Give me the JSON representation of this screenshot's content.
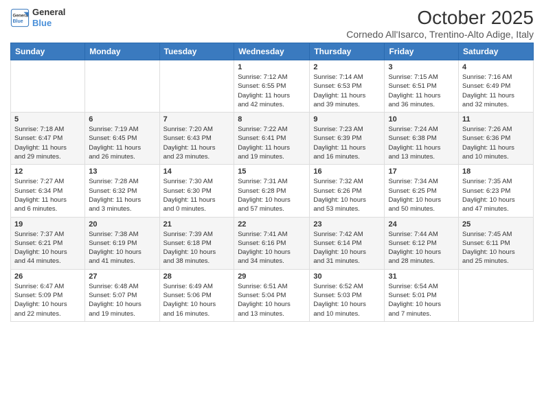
{
  "header": {
    "logo_line1": "General",
    "logo_line2": "Blue",
    "month_title": "October 2025",
    "subtitle": "Cornedo All'Isarco, Trentino-Alto Adige, Italy"
  },
  "weekdays": [
    "Sunday",
    "Monday",
    "Tuesday",
    "Wednesday",
    "Thursday",
    "Friday",
    "Saturday"
  ],
  "weeks": [
    [
      {
        "day": "",
        "info": ""
      },
      {
        "day": "",
        "info": ""
      },
      {
        "day": "",
        "info": ""
      },
      {
        "day": "1",
        "info": "Sunrise: 7:12 AM\nSunset: 6:55 PM\nDaylight: 11 hours\nand 42 minutes."
      },
      {
        "day": "2",
        "info": "Sunrise: 7:14 AM\nSunset: 6:53 PM\nDaylight: 11 hours\nand 39 minutes."
      },
      {
        "day": "3",
        "info": "Sunrise: 7:15 AM\nSunset: 6:51 PM\nDaylight: 11 hours\nand 36 minutes."
      },
      {
        "day": "4",
        "info": "Sunrise: 7:16 AM\nSunset: 6:49 PM\nDaylight: 11 hours\nand 32 minutes."
      }
    ],
    [
      {
        "day": "5",
        "info": "Sunrise: 7:18 AM\nSunset: 6:47 PM\nDaylight: 11 hours\nand 29 minutes."
      },
      {
        "day": "6",
        "info": "Sunrise: 7:19 AM\nSunset: 6:45 PM\nDaylight: 11 hours\nand 26 minutes."
      },
      {
        "day": "7",
        "info": "Sunrise: 7:20 AM\nSunset: 6:43 PM\nDaylight: 11 hours\nand 23 minutes."
      },
      {
        "day": "8",
        "info": "Sunrise: 7:22 AM\nSunset: 6:41 PM\nDaylight: 11 hours\nand 19 minutes."
      },
      {
        "day": "9",
        "info": "Sunrise: 7:23 AM\nSunset: 6:39 PM\nDaylight: 11 hours\nand 16 minutes."
      },
      {
        "day": "10",
        "info": "Sunrise: 7:24 AM\nSunset: 6:38 PM\nDaylight: 11 hours\nand 13 minutes."
      },
      {
        "day": "11",
        "info": "Sunrise: 7:26 AM\nSunset: 6:36 PM\nDaylight: 11 hours\nand 10 minutes."
      }
    ],
    [
      {
        "day": "12",
        "info": "Sunrise: 7:27 AM\nSunset: 6:34 PM\nDaylight: 11 hours\nand 6 minutes."
      },
      {
        "day": "13",
        "info": "Sunrise: 7:28 AM\nSunset: 6:32 PM\nDaylight: 11 hours\nand 3 minutes."
      },
      {
        "day": "14",
        "info": "Sunrise: 7:30 AM\nSunset: 6:30 PM\nDaylight: 11 hours\nand 0 minutes."
      },
      {
        "day": "15",
        "info": "Sunrise: 7:31 AM\nSunset: 6:28 PM\nDaylight: 10 hours\nand 57 minutes."
      },
      {
        "day": "16",
        "info": "Sunrise: 7:32 AM\nSunset: 6:26 PM\nDaylight: 10 hours\nand 53 minutes."
      },
      {
        "day": "17",
        "info": "Sunrise: 7:34 AM\nSunset: 6:25 PM\nDaylight: 10 hours\nand 50 minutes."
      },
      {
        "day": "18",
        "info": "Sunrise: 7:35 AM\nSunset: 6:23 PM\nDaylight: 10 hours\nand 47 minutes."
      }
    ],
    [
      {
        "day": "19",
        "info": "Sunrise: 7:37 AM\nSunset: 6:21 PM\nDaylight: 10 hours\nand 44 minutes."
      },
      {
        "day": "20",
        "info": "Sunrise: 7:38 AM\nSunset: 6:19 PM\nDaylight: 10 hours\nand 41 minutes."
      },
      {
        "day": "21",
        "info": "Sunrise: 7:39 AM\nSunset: 6:18 PM\nDaylight: 10 hours\nand 38 minutes."
      },
      {
        "day": "22",
        "info": "Sunrise: 7:41 AM\nSunset: 6:16 PM\nDaylight: 10 hours\nand 34 minutes."
      },
      {
        "day": "23",
        "info": "Sunrise: 7:42 AM\nSunset: 6:14 PM\nDaylight: 10 hours\nand 31 minutes."
      },
      {
        "day": "24",
        "info": "Sunrise: 7:44 AM\nSunset: 6:12 PM\nDaylight: 10 hours\nand 28 minutes."
      },
      {
        "day": "25",
        "info": "Sunrise: 7:45 AM\nSunset: 6:11 PM\nDaylight: 10 hours\nand 25 minutes."
      }
    ],
    [
      {
        "day": "26",
        "info": "Sunrise: 6:47 AM\nSunset: 5:09 PM\nDaylight: 10 hours\nand 22 minutes."
      },
      {
        "day": "27",
        "info": "Sunrise: 6:48 AM\nSunset: 5:07 PM\nDaylight: 10 hours\nand 19 minutes."
      },
      {
        "day": "28",
        "info": "Sunrise: 6:49 AM\nSunset: 5:06 PM\nDaylight: 10 hours\nand 16 minutes."
      },
      {
        "day": "29",
        "info": "Sunrise: 6:51 AM\nSunset: 5:04 PM\nDaylight: 10 hours\nand 13 minutes."
      },
      {
        "day": "30",
        "info": "Sunrise: 6:52 AM\nSunset: 5:03 PM\nDaylight: 10 hours\nand 10 minutes."
      },
      {
        "day": "31",
        "info": "Sunrise: 6:54 AM\nSunset: 5:01 PM\nDaylight: 10 hours\nand 7 minutes."
      },
      {
        "day": "",
        "info": ""
      }
    ]
  ]
}
